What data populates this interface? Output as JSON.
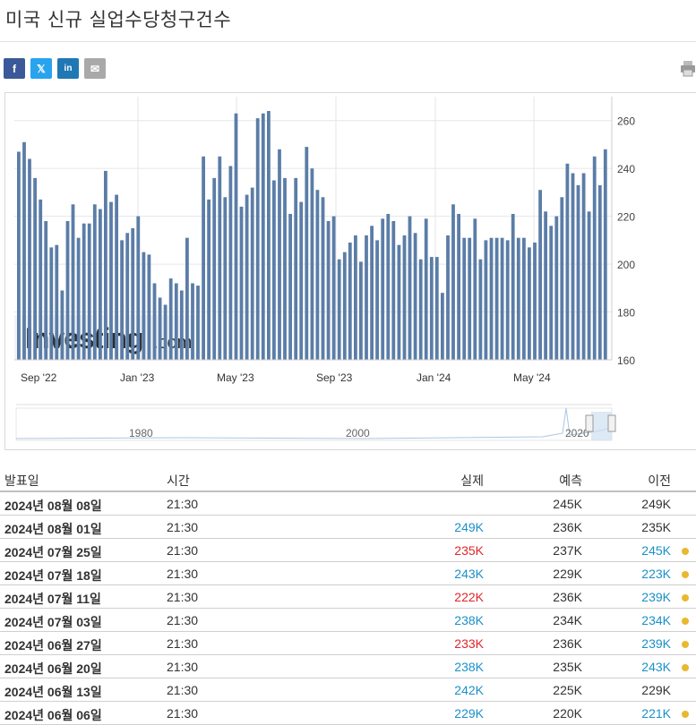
{
  "page": {
    "title": "미국 신규 실업수당청구건수"
  },
  "share": {
    "facebook": "f",
    "twitter": "𝕏",
    "linkedin": "in",
    "email": "✉"
  },
  "icons": {
    "print": "print-icon"
  },
  "colors": {
    "bar": "#5b7da7",
    "positive": "#1a90c9",
    "negative": "#e0262a",
    "dot": "#e8b830"
  },
  "chart_data": {
    "type": "bar",
    "ylim": [
      160,
      270
    ],
    "yticks": [
      160,
      180,
      200,
      220,
      240,
      260
    ],
    "xtick_labels": [
      "Sep '22",
      "Jan '23",
      "May '23",
      "Sep '23",
      "Jan '24",
      "May '24"
    ],
    "values": [
      247,
      251,
      244,
      236,
      227,
      218,
      207,
      208,
      189,
      218,
      225,
      211,
      217,
      217,
      225,
      223,
      239,
      226,
      229,
      210,
      213,
      215,
      220,
      205,
      204,
      192,
      186,
      183,
      194,
      192,
      189,
      211,
      192,
      191,
      245,
      227,
      236,
      245,
      228,
      241,
      263,
      224,
      229,
      232,
      261,
      263,
      264,
      235,
      248,
      236,
      221,
      236,
      226,
      249,
      240,
      231,
      228,
      218,
      220,
      202,
      205,
      209,
      212,
      201,
      212,
      216,
      210,
      219,
      221,
      218,
      208,
      212,
      220,
      213,
      202,
      219,
      203,
      203,
      188,
      212,
      225,
      221,
      211,
      211,
      219,
      202,
      210,
      211,
      211,
      211,
      210,
      221,
      211,
      211,
      207,
      209,
      231,
      222,
      216,
      220,
      228,
      242,
      238,
      233,
      238,
      222,
      245,
      233,
      248
    ],
    "navigator": {
      "labels": [
        "1980",
        "2000",
        "2020"
      ]
    }
  },
  "table": {
    "headers": {
      "date": "발표일",
      "time": "시간",
      "actual": "실제",
      "forecast": "예측",
      "previous": "이전"
    },
    "rows": [
      {
        "date": "2024년 08월 08일",
        "time": "21:30",
        "actual": "",
        "forecast": "245K",
        "previous": "249K"
      },
      {
        "date": "2024년 08월 01일",
        "time": "21:30",
        "actual": "249K",
        "forecast": "236K",
        "previous": "235K"
      },
      {
        "date": "2024년 07월 25일",
        "time": "21:30",
        "actual": "235K",
        "forecast": "237K",
        "previous": "245K"
      },
      {
        "date": "2024년 07월 18일",
        "time": "21:30",
        "actual": "243K",
        "forecast": "229K",
        "previous": "223K"
      },
      {
        "date": "2024년 07월 11일",
        "time": "21:30",
        "actual": "222K",
        "forecast": "236K",
        "previous": "239K"
      },
      {
        "date": "2024년 07월 03일",
        "time": "21:30",
        "actual": "238K",
        "forecast": "234K",
        "previous": "234K"
      },
      {
        "date": "2024년 06월 27일",
        "time": "21:30",
        "actual": "233K",
        "forecast": "236K",
        "previous": "239K"
      },
      {
        "date": "2024년 06월 20일",
        "time": "21:30",
        "actual": "238K",
        "forecast": "235K",
        "previous": "243K"
      },
      {
        "date": "2024년 06월 13일",
        "time": "21:30",
        "actual": "242K",
        "forecast": "225K",
        "previous": "229K"
      },
      {
        "date": "2024년 06월 06일",
        "time": "21:30",
        "actual": "229K",
        "forecast": "220K",
        "previous": "221K"
      }
    ],
    "actual_status": [
      "",
      "green",
      "red",
      "green",
      "red",
      "green",
      "red",
      "green",
      "green",
      "green"
    ],
    "previous_status": [
      "",
      "",
      "green",
      "green",
      "green",
      "green",
      "green",
      "green",
      "",
      "green"
    ],
    "revised_dot": [
      false,
      false,
      true,
      true,
      true,
      true,
      true,
      true,
      false,
      true
    ]
  }
}
